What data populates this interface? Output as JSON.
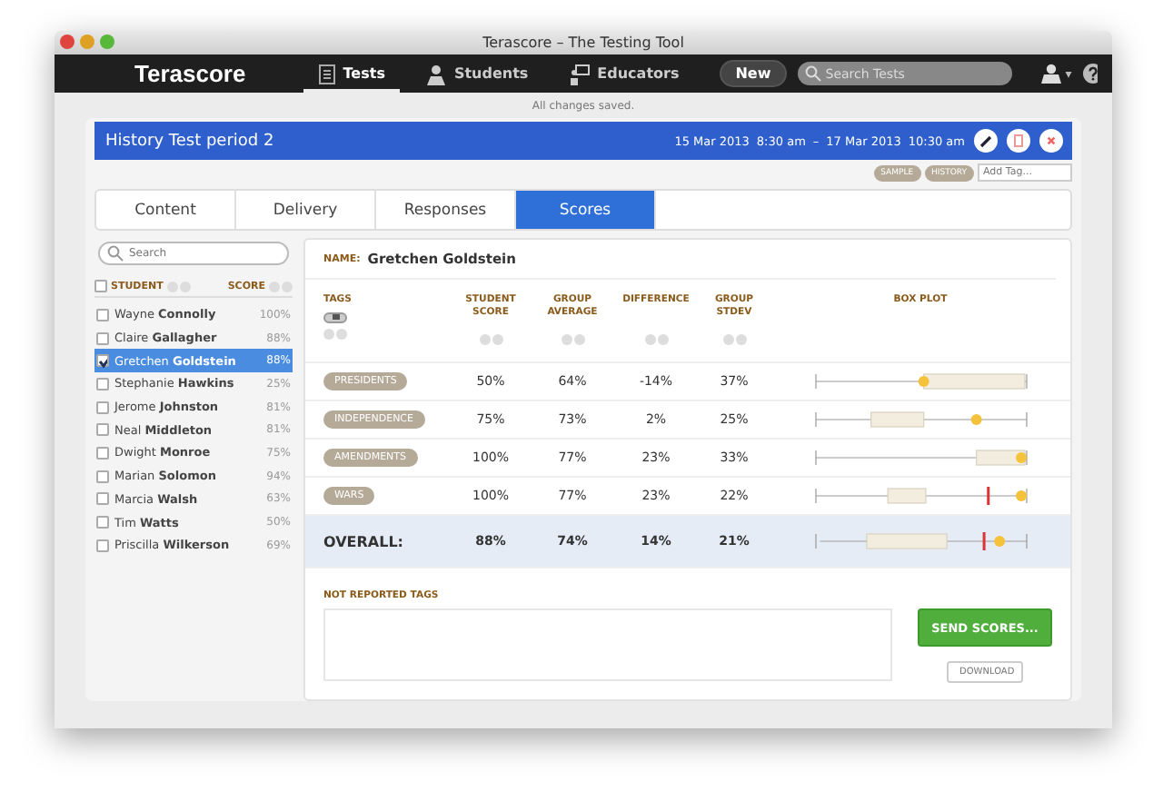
{
  "window": {
    "title": "Terascore – The Testing Tool"
  },
  "nav": {
    "logo": "Terascore",
    "items": [
      {
        "label": "Tests",
        "selected": true
      },
      {
        "label": "Students",
        "selected": false
      },
      {
        "label": "Educators",
        "selected": false
      }
    ],
    "new_button": "New",
    "search": {
      "placeholder": "Search Tests"
    },
    "user_caret": "▾"
  },
  "save_status": "All changes saved.",
  "test": {
    "title": "History Test period 2",
    "start_date": "15 Mar 2013",
    "start_time": "8:30 am",
    "separator": "–",
    "end_date": "17 Mar 2013",
    "end_time": "10:30 am",
    "tags": [
      "SAMPLE",
      "HISTORY"
    ],
    "add_tag": {
      "placeholder": "Add Tag..."
    }
  },
  "tabs": [
    {
      "label": "Content",
      "selected": false
    },
    {
      "label": "Delivery",
      "selected": false
    },
    {
      "label": "Responses",
      "selected": false
    },
    {
      "label": "Scores",
      "selected": true
    }
  ],
  "student_list": {
    "search": {
      "placeholder": "Search"
    },
    "columns": [
      "STUDENT",
      "SCORE"
    ],
    "select_all": {
      "checked": false
    },
    "students": [
      {
        "name": "Wayne **Connolly**",
        "score": "100%",
        "checked": false,
        "selected": false
      },
      {
        "name": "Claire **Gallagher**",
        "score": "88%",
        "checked": false,
        "selected": false
      },
      {
        "name": "Gretchen **Goldstein**",
        "score": "88%",
        "checked": true,
        "selected": true
      },
      {
        "name": "Stephanie **Hawkins**",
        "score": "25%",
        "checked": false,
        "selected": false
      },
      {
        "name": "Jerome **Johnston**",
        "score": "81%",
        "checked": false,
        "selected": false
      },
      {
        "name": "Neal **Middleton**",
        "score": "81%",
        "checked": false,
        "selected": false
      },
      {
        "name": "Dwight **Monroe**",
        "score": "75%",
        "checked": false,
        "selected": false
      },
      {
        "name": "Marian **Solomon**",
        "score": "94%",
        "checked": false,
        "selected": false
      },
      {
        "name": "Marcia **Walsh**",
        "score": "63%",
        "checked": false,
        "selected": false
      },
      {
        "name": "Tim **Watts**",
        "score": "50%",
        "checked": false,
        "selected": false
      },
      {
        "name": "Priscilla **Wilkerson**",
        "score": "69%",
        "checked": false,
        "selected": false
      }
    ]
  },
  "detail": {
    "name_label": "NAME:",
    "name": "Gretchen Goldstein",
    "tag_toggle": {
      "on": false
    },
    "columns": [
      "TAGS",
      "STUDENT SCORE",
      "GROUP AVERAGE",
      "DIFFERENCE",
      "GROUP STDEV",
      "BOX PLOT"
    ],
    "rows": [
      {
        "tag": "PRESIDENTS",
        "student_score": "50%",
        "group_average": "64%",
        "difference": "-14%",
        "group_stdev": "37%"
      },
      {
        "tag": "INDEPENDENCE",
        "student_score": "75%",
        "group_average": "73%",
        "difference": "2%",
        "group_stdev": "25%"
      },
      {
        "tag": "AMENDMENTS",
        "student_score": "100%",
        "group_average": "77%",
        "difference": "23%",
        "group_stdev": "33%"
      },
      {
        "tag": "WARS",
        "student_score": "100%",
        "group_average": "77%",
        "difference": "23%",
        "group_stdev": "22%"
      }
    ],
    "overall": {
      "label": "OVERALL:",
      "student_score": "88%",
      "group_average": "74%",
      "difference": "14%",
      "group_stdev": "21%"
    },
    "not_reported_label": "NOT REPORTED TAGS",
    "send_button": "SEND SCORES...",
    "download_button": "DOWNLOAD"
  }
}
